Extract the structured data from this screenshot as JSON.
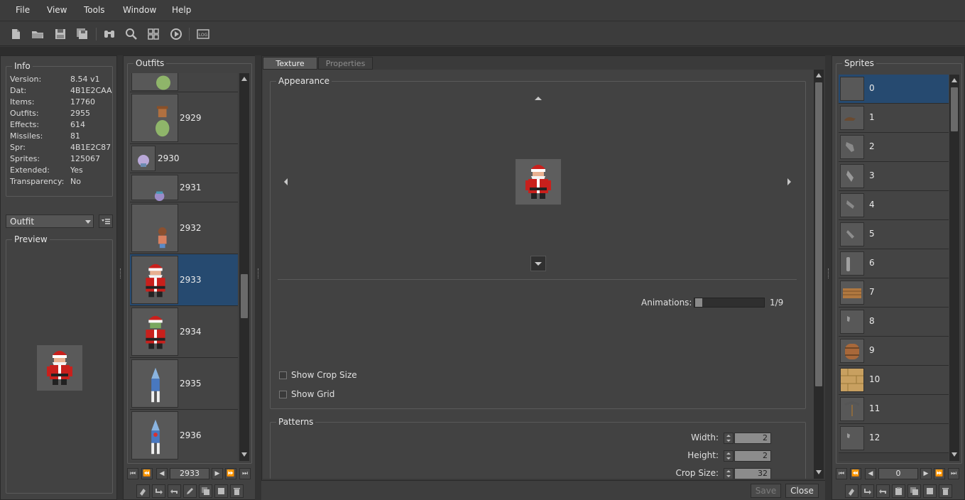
{
  "menu": [
    "File",
    "View",
    "Tools",
    "Window",
    "Help"
  ],
  "toolbar": {
    "icons": [
      "new-file-icon",
      "open-folder-icon",
      "save-icon",
      "save-as-icon",
      "find-icon",
      "search-icon",
      "sprite-grid-icon",
      "play-icon",
      "log-icon"
    ]
  },
  "info": {
    "title": "Info",
    "rows": [
      {
        "key": "Version:",
        "value": "8.54 v1"
      },
      {
        "key": "Dat:",
        "value": "4B1E2CAA"
      },
      {
        "key": "Items:",
        "value": "17760"
      },
      {
        "key": "Outfits:",
        "value": "2955"
      },
      {
        "key": "Effects:",
        "value": "614"
      },
      {
        "key": "Missiles:",
        "value": "81"
      },
      {
        "key": "Spr:",
        "value": "4B1E2C87"
      },
      {
        "key": "Sprites:",
        "value": "125067"
      },
      {
        "key": "Extended:",
        "value": "Yes"
      },
      {
        "key": "Transparency:",
        "value": "No"
      }
    ]
  },
  "category_select": {
    "value": "Outfit"
  },
  "preview": {
    "title": "Preview"
  },
  "outfits": {
    "title": "Outfits",
    "items": [
      {
        "id": "2929"
      },
      {
        "id": "2930"
      },
      {
        "id": "2931"
      },
      {
        "id": "2932"
      },
      {
        "id": "2933",
        "selected": true
      },
      {
        "id": "2934"
      },
      {
        "id": "2935"
      },
      {
        "id": "2936"
      }
    ],
    "page_value": "2933"
  },
  "tabs": {
    "texture": "Texture",
    "properties": "Properties"
  },
  "appearance": {
    "title": "Appearance",
    "animations_label": "Animations:",
    "animations_value": "1/9",
    "animation_progress": 0.111,
    "show_crop_size": "Show Crop Size",
    "show_grid": "Show Grid"
  },
  "patterns": {
    "title": "Patterns",
    "width_label": "Width:",
    "width_value": "2",
    "height_label": "Height:",
    "height_value": "2",
    "crop_label": "Crop Size:",
    "crop_value": "32"
  },
  "buttons": {
    "save": "Save",
    "close": "Close"
  },
  "sprites": {
    "title": "Sprites",
    "items": [
      "0",
      "1",
      "2",
      "3",
      "4",
      "5",
      "6",
      "7",
      "8",
      "9",
      "10",
      "11",
      "12"
    ],
    "page_value": "0"
  },
  "colors": {
    "selection": "#264a70",
    "panel": "#424242",
    "santa_red": "#c8201c"
  }
}
